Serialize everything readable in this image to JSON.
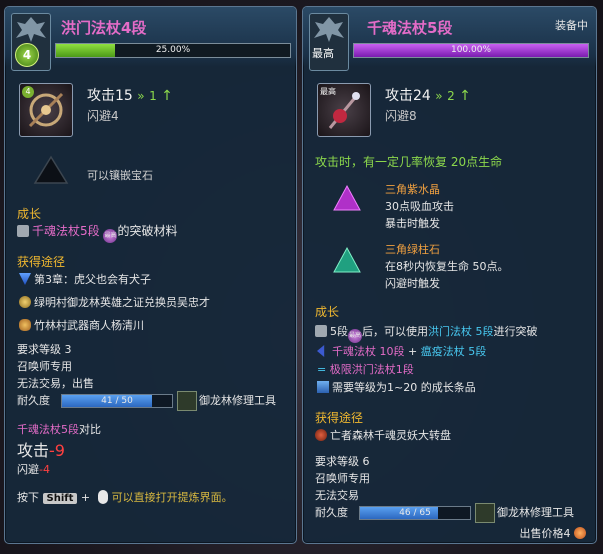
{
  "left": {
    "name": "洪门法杖4段",
    "level_badge": "4",
    "progress_label": "25.00%",
    "progress": 0.25,
    "attack_label": "攻击15",
    "attack_delta": "1",
    "evade": "闪避4",
    "socket_text": "可以镶嵌宝石",
    "growth_title": "成长",
    "growth_item": "千魂法杖5段",
    "growth_suffix": "的突破材料",
    "growth_badge": "最高",
    "acquire_title": "获得途径",
    "acquire": [
      "第3章：虎父也会有犬子",
      "绿明村御龙林英雄之证兑换员吴忠才",
      "竹林村武器商人杨清川"
    ],
    "req_level": "要求等级 3",
    "class_only": "召唤师专用",
    "trade": "无法交易，出售",
    "durability_label": "耐久度",
    "durability_text": "41 / 50",
    "durability": 0.82,
    "repair_tool": "御龙林修理工具",
    "compare_title_item": "千魂法杖5段",
    "compare_title_suffix": "对比",
    "compare_attack": "攻击",
    "compare_attack_val": "-9",
    "compare_evade": "闪避",
    "compare_evade_val": "-4",
    "hint_press": "按下",
    "hint_key": "Shift",
    "hint_plus": "+",
    "hint_text": "可以直接打开提炼界面。"
  },
  "right": {
    "name": "千魂法杖5段",
    "equipped": "装备中",
    "level_badge": "最高",
    "progress_label": "100.00%",
    "progress": 1.0,
    "icon_badge": "最高",
    "attack_label": "攻击24",
    "attack_delta": "2",
    "evade": "闪避8",
    "effect": "攻击时，有一定几率恢复 20点生命",
    "gems": [
      {
        "name": "三角紫水晶",
        "line1": "30点吸血攻击",
        "line2": "暴击时触发",
        "color": "#c040d0"
      },
      {
        "name": "三角绿柱石",
        "line1": "在8秒内恢复生命 50点。",
        "line2": "闪避时触发",
        "color": "#30c090"
      }
    ],
    "growth_title": "成长",
    "growth_line_a": "5段",
    "growth_line_badge": "最高",
    "growth_line_b": "后，可以使用",
    "growth_line_item": "洪门法杖 5段",
    "growth_line_c": "进行突破",
    "growth_recipe_a": "千魂法杖 10段",
    "growth_recipe_plus": "+",
    "growth_recipe_b": "瘟疫法杖 5段",
    "growth_result_prefix": "=",
    "growth_result": "极限洪门法杖1段",
    "growth_req": "需要等级为1~20 的成长条品",
    "acquire_title": "获得途径",
    "acquire": [
      "亡者森林千魂灵妖大转盘"
    ],
    "req_level": "要求等级 6",
    "class_only": "召唤师专用",
    "trade": "无法交易",
    "durability_label": "耐久度",
    "durability_text": "46 / 65",
    "durability": 0.7077,
    "repair_tool": "御龙林修理工具",
    "sell_label": "出售价格",
    "sell_value": "4"
  },
  "colors": {
    "panel_bg": "#16283a",
    "section_title": "#f0b830",
    "item_pink": "#e46cc8",
    "effect_green": "#8cd84c",
    "gem_orange": "#f0a040",
    "negative_red": "#ff4040",
    "link_cyan": "#48c8f0",
    "progress_green": "#70c030",
    "progress_purple": "#b040e0"
  }
}
